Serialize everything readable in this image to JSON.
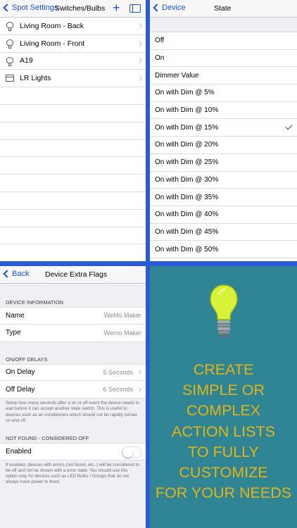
{
  "switches": {
    "back_label": "Spot Settings",
    "title": "Switches/Bulbs",
    "add_icon": "plus-icon",
    "split_icon": "split-view-icon",
    "items": [
      {
        "label": "Living Room - Back",
        "icon": "bulb-icon"
      },
      {
        "label": "Living Room - Front",
        "icon": "bulb-icon"
      },
      {
        "label": "A19",
        "icon": "bulb-icon"
      },
      {
        "label": "LR Lights",
        "icon": "folder-icon"
      }
    ]
  },
  "state": {
    "back_label": "Device",
    "title": "State",
    "selected": "On with Dim @ 15%",
    "options": [
      "Off",
      "On",
      "Dimmer Value",
      "On with Dim @ 5%",
      "On with Dim @ 10%",
      "On with Dim @ 15%",
      "On with Dim @ 20%",
      "On with Dim @ 25%",
      "On with Dim @ 30%",
      "On with Dim @ 35%",
      "On with Dim @ 40%",
      "On with Dim @ 45%",
      "On with Dim @ 50%"
    ]
  },
  "flags": {
    "back_label": "Back",
    "title": "Device Extra Flags",
    "device_info_header": "DEVICE INFORMATION",
    "name_label": "Name",
    "name_value": "WeMo Maker",
    "type_label": "Type",
    "type_value": "Wemo Maker",
    "delays_header": "ON/OFF DELAYS",
    "on_delay_label": "On Delay",
    "on_delay_value": "5 Seconds",
    "off_delay_label": "Off Delay",
    "off_delay_value": "6 Seconds",
    "delays_note": "Setup how many seconds after a on or off event the device needs to wait before it can accept another state switch. This is useful to devices such as air conditioners which should not be rapidly turned on and off.",
    "notfound_header": "NOT FOUND - CONSIDERED OFF",
    "enabled_label": "Enabled",
    "enabled": false,
    "notfound_note": "If enabled, devices with errors (not found, etc..) will be considered to be off and not be shown with a error state. You should use this option only for devices such as LED Bulbs / Groups that do not always have power to them."
  },
  "promo": {
    "lines": [
      "CREATE",
      "SIMPLE OR",
      "COMPLEX",
      "ACTION LISTS",
      "TO FULLY",
      "CUSTOMIZE",
      "FOR YOUR NEEDS"
    ],
    "icon": "lightbulb-icon",
    "text_color": "#e3b417",
    "background": "#2f8594"
  },
  "colors": {
    "accent": "#1b4fe0",
    "divider": "#2a5bd7"
  }
}
